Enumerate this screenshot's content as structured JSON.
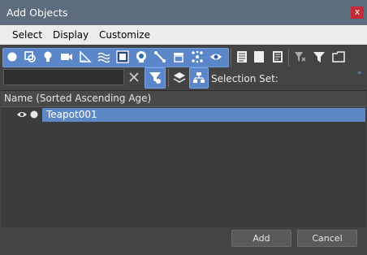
{
  "window": {
    "title": "Add Objects",
    "close_label": "x"
  },
  "menu": {
    "items": [
      "Select",
      "Display",
      "Customize"
    ]
  },
  "toolbar": {
    "filter_icons": [
      "geometry-filter-icon",
      "shapes-filter-icon",
      "lights-filter-icon",
      "cameras-filter-icon",
      "helpers-filter-icon",
      "space-warps-filter-icon",
      "groups-filter-icon",
      "xrefs-filter-icon",
      "bones-filter-icon",
      "containers-filter-icon",
      "particle-systems-filter-icon",
      "frozen-filter-icon",
      "hidden-filter-icon"
    ],
    "selection_set_label": "Selection Set:",
    "expand_label": "»"
  },
  "search": {
    "value": "",
    "placeholder": ""
  },
  "list": {
    "column_header": "Name (Sorted Ascending Age)",
    "rows": [
      {
        "name": "Teapot001",
        "selected": true
      }
    ]
  },
  "buttons": {
    "add": "Add",
    "cancel": "Cancel"
  },
  "colors": {
    "accent": "#5c88c5",
    "close": "#c42b36",
    "titlebar": "#5d6d7e"
  }
}
